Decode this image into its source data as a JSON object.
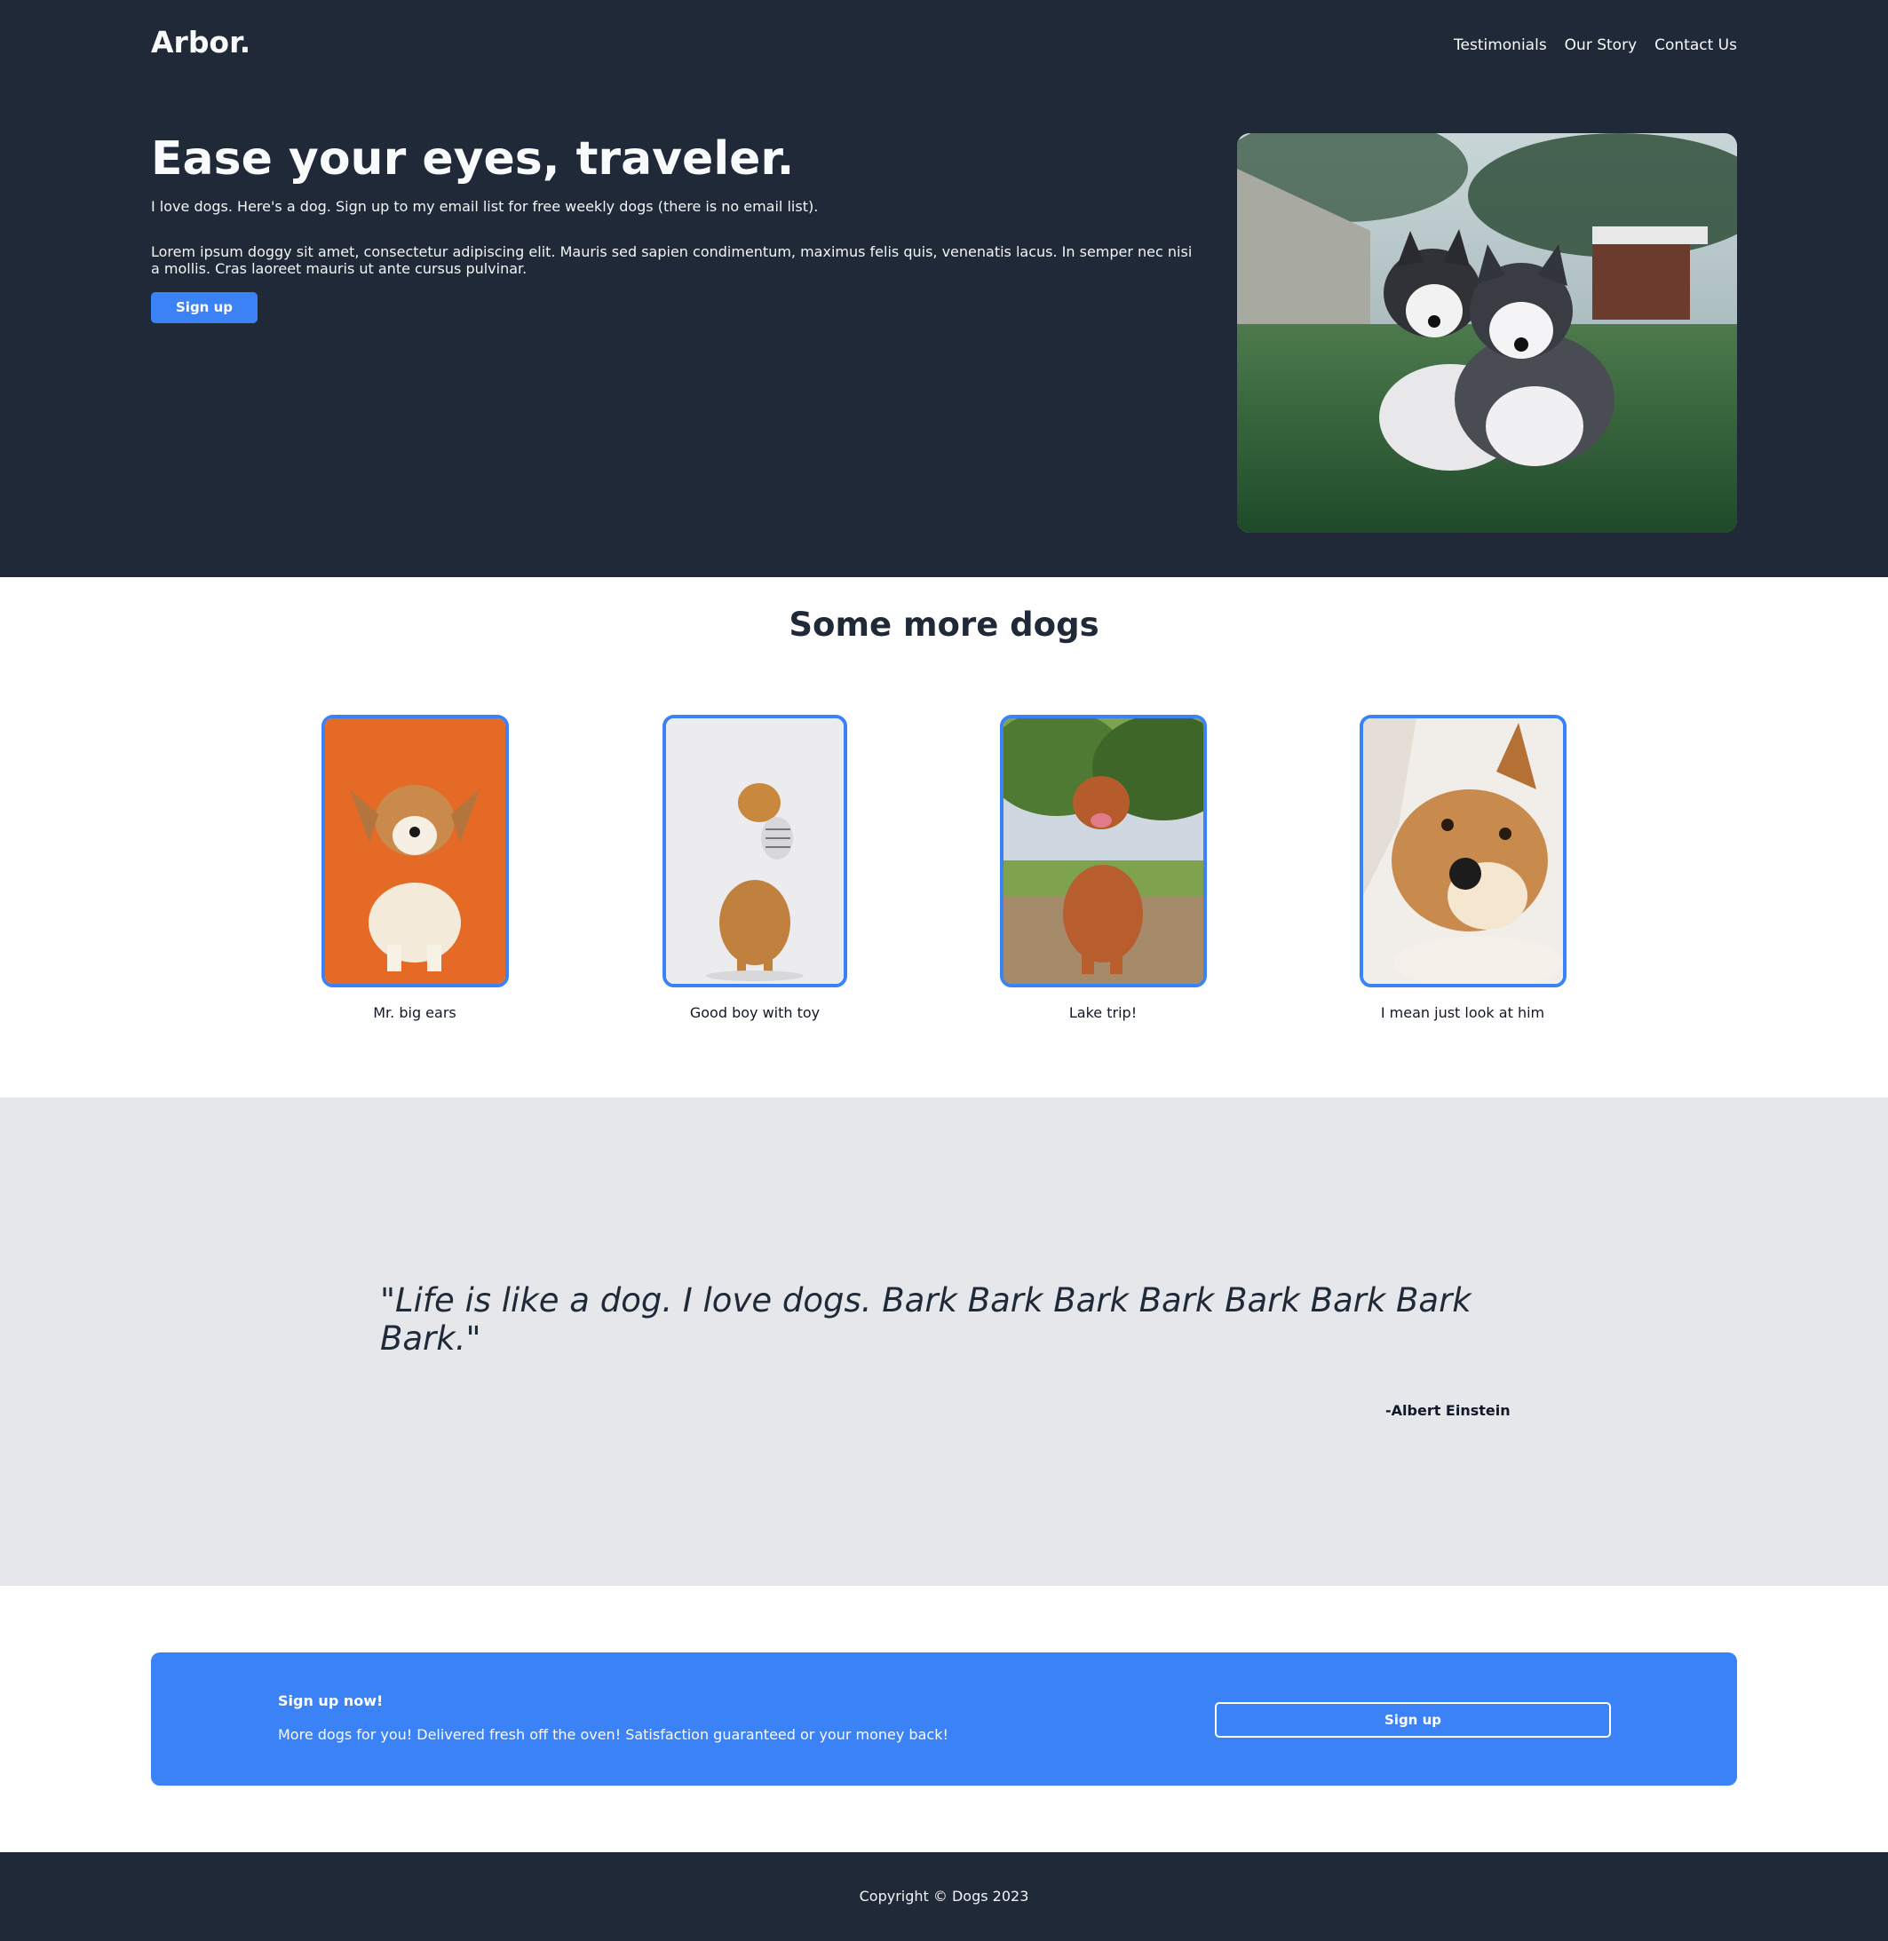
{
  "brand": {
    "logo": "Arbor."
  },
  "nav": {
    "items": [
      "Testimonials",
      "Our Story",
      "Contact Us"
    ]
  },
  "hero": {
    "title": "Ease your eyes, traveler.",
    "lead": "I love dogs. Here's a dog. Sign up to my email list for free weekly dogs (there is no email list).",
    "body": "Lorem ipsum doggy sit amet, consectetur adipiscing elit. Mauris sed sapien condimentum, maximus felis quis, venenatis lacus. In semper nec nisi a mollis. Cras laoreet mauris ut ante cursus pulvinar.",
    "button_label": "Sign up",
    "image_icon": "husky-puppies-photo"
  },
  "dogs": {
    "title": "Some more dogs",
    "cards": [
      {
        "caption": "Mr. big ears",
        "icon": "corgi-puppy-photo"
      },
      {
        "caption": "Good boy with toy",
        "icon": "golden-retriever-toy-photo"
      },
      {
        "caption": "Lake trip!",
        "icon": "retriever-lake-photo"
      },
      {
        "caption": "I mean just look at him",
        "icon": "smiling-dog-photo"
      }
    ]
  },
  "quote": {
    "text": "\"Life is like a dog. I love dogs. Bark Bark Bark Bark Bark Bark Bark Bark.\"",
    "author": "-Albert Einstein"
  },
  "cta": {
    "title": "Sign up now!",
    "text": "More dogs for you! Delivered fresh off the oven! Satisfaction guaranteed or your money back!",
    "button_label": "Sign up"
  },
  "footer": {
    "copyright": "Copyright © Dogs 2023"
  },
  "colors": {
    "dark": "#1f2937",
    "accent": "#3b82f6",
    "band": "#e5e7eb"
  }
}
